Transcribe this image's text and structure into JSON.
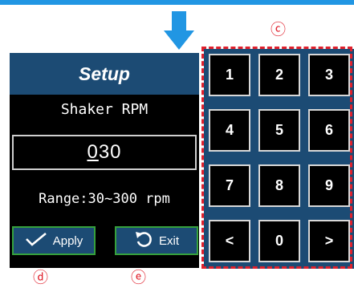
{
  "arrow_icon": "down-arrow-icon",
  "callouts": {
    "c": "ⓒ",
    "d": "ⓓ",
    "e": "ⓔ"
  },
  "setup": {
    "title": "Setup",
    "parameter_label": "Shaker RPM",
    "value_prefix": "",
    "value_cursor_digit": "0",
    "value_rest": "30",
    "range_label": "Range:30~300 rpm"
  },
  "buttons": {
    "apply_label": "Apply",
    "apply_icon": "checkmark-icon",
    "exit_label": "Exit",
    "exit_icon": "undo-arrow-icon"
  },
  "keypad": {
    "keys": [
      "1",
      "2",
      "3",
      "4",
      "5",
      "6",
      "7",
      "8",
      "9",
      "<",
      "0",
      ">"
    ]
  },
  "colors": {
    "accent_blue": "#2196e3",
    "panel_blue": "#1c4b74",
    "button_border_green": "#36a13c",
    "callout_red": "#e0202c"
  }
}
